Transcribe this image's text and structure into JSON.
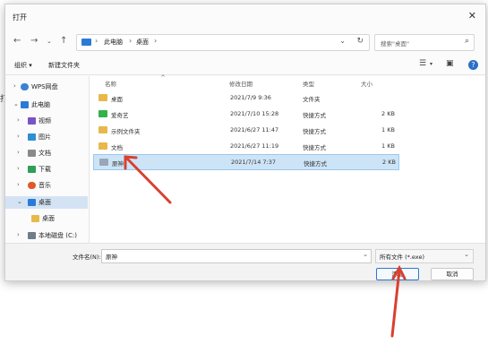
{
  "background": {
    "text": "打开"
  },
  "window": {
    "title": "打开"
  },
  "nav": {
    "breadcrumb": [
      "此电脑",
      "桌面"
    ],
    "search_placeholder": "搜索\"桌面\""
  },
  "toolbar": {
    "organize": "组织 ▾",
    "new_folder": "新建文件夹"
  },
  "sidebar": {
    "items": [
      {
        "label": "WPS网盘",
        "icon": "cloud-icon",
        "color": "#3b82d6"
      },
      {
        "label": "此电脑",
        "icon": "computer-icon",
        "color": "#2b7bd6"
      },
      {
        "label": "视频",
        "icon": "video-icon",
        "color": "#7a52c7"
      },
      {
        "label": "图片",
        "icon": "pictures-icon",
        "color": "#2d8fd5"
      },
      {
        "label": "文档",
        "icon": "documents-icon",
        "color": "#8a8a8a"
      },
      {
        "label": "下载",
        "icon": "download-icon",
        "color": "#2f9e5a"
      },
      {
        "label": "音乐",
        "icon": "music-icon",
        "color": "#e0582a"
      },
      {
        "label": "桌面",
        "icon": "desktop-icon",
        "color": "#2b7bd6"
      },
      {
        "label": "桌面",
        "icon": "folder-icon",
        "color": "#e8b84a"
      },
      {
        "label": "本地磁盘 (C:)",
        "icon": "drive-icon",
        "color": "#6f7c8a"
      }
    ]
  },
  "columns": {
    "name": "名称",
    "date": "修改日期",
    "type": "类型",
    "size": "大小"
  },
  "files": [
    {
      "name": "桌面",
      "date": "2021/7/9 9:36",
      "type": "文件夹",
      "size": "",
      "icon": "folder-icon",
      "color": "#e8b84a"
    },
    {
      "name": "爱奇艺",
      "date": "2021/7/10 15:28",
      "type": "快捷方式",
      "size": "2 KB",
      "icon": "app-shortcut-icon",
      "color": "#2fb34a"
    },
    {
      "name": "示例文件夹",
      "date": "2021/6/27 11:47",
      "type": "快捷方式",
      "size": "1 KB",
      "icon": "folder-shortcut-icon",
      "color": "#e8b84a"
    },
    {
      "name": "文档",
      "date": "2021/6/27 11:19",
      "type": "快捷方式",
      "size": "1 KB",
      "icon": "folder-shortcut-icon",
      "color": "#e8b84a"
    },
    {
      "name": "原神",
      "date": "2021/7/14 7:37",
      "type": "快捷方式",
      "size": "2 KB",
      "icon": "game-shortcut-icon",
      "color": "#9aa6b8"
    }
  ],
  "footer": {
    "filename_label": "文件名(N):",
    "filename_value": "原神",
    "filetype_value": "所有文件 (*.exe)",
    "add_button": "添加",
    "cancel_button": "取消"
  },
  "accent": "#2b78d0"
}
